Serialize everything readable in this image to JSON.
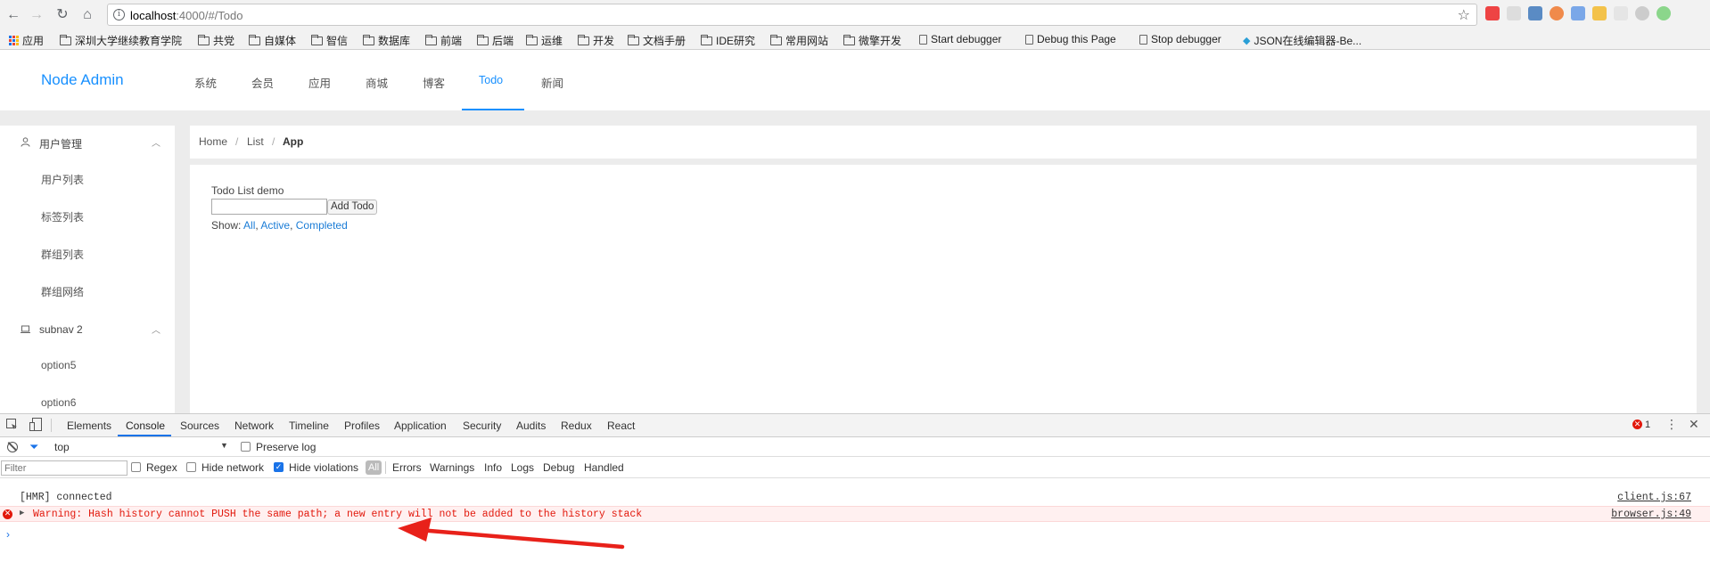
{
  "browser": {
    "url_host": "localhost",
    "url_rest": ":4000/#/Todo",
    "bookmarks": [
      "应用",
      "深圳大学继续教育学院",
      "共党",
      "自媒体",
      "智信",
      "数据库",
      "前端",
      "后端",
      "运维",
      "开发",
      "文档手册",
      "IDE研究",
      "常用网站",
      "微擎开发",
      "Start debugger",
      "Debug this Page",
      "Stop debugger",
      "JSON在线编辑器-Be..."
    ]
  },
  "app": {
    "logo": "Node Admin",
    "topnav": [
      "系统",
      "会员",
      "应用",
      "商城",
      "博客",
      "Todo",
      "新闻"
    ],
    "sidebar": {
      "sub1": "用户管理",
      "sub1_items": [
        "用户列表",
        "标签列表",
        "群组列表",
        "群组网络"
      ],
      "sub2": "subnav 2",
      "sub2_items": [
        "option5",
        "option6"
      ]
    },
    "breadcrumb": [
      "Home",
      "List",
      "App"
    ],
    "todo": {
      "title": "Todo List demo",
      "add_label": "Add Todo",
      "show_label": "Show:",
      "filters": [
        "All",
        "Active",
        "Completed"
      ]
    }
  },
  "devtools": {
    "tabs": [
      "Elements",
      "Console",
      "Sources",
      "Network",
      "Timeline",
      "Profiles",
      "Application",
      "Security",
      "Audits",
      "Redux",
      "React"
    ],
    "error_count": "1",
    "context": "top",
    "preserve_log": "Preserve log",
    "filter_placeholder": "Filter",
    "regex": "Regex",
    "hide_network": "Hide network",
    "hide_violations": "Hide violations",
    "all": "All",
    "levels": [
      "Errors",
      "Warnings",
      "Info",
      "Logs",
      "Debug",
      "Handled"
    ],
    "logs": [
      {
        "msg": "[HMR] connected",
        "src": "client.js:67"
      },
      {
        "msg": "Warning: Hash history cannot PUSH the same path; a new entry will not be added to the history stack",
        "src": "browser.js:49"
      }
    ]
  }
}
